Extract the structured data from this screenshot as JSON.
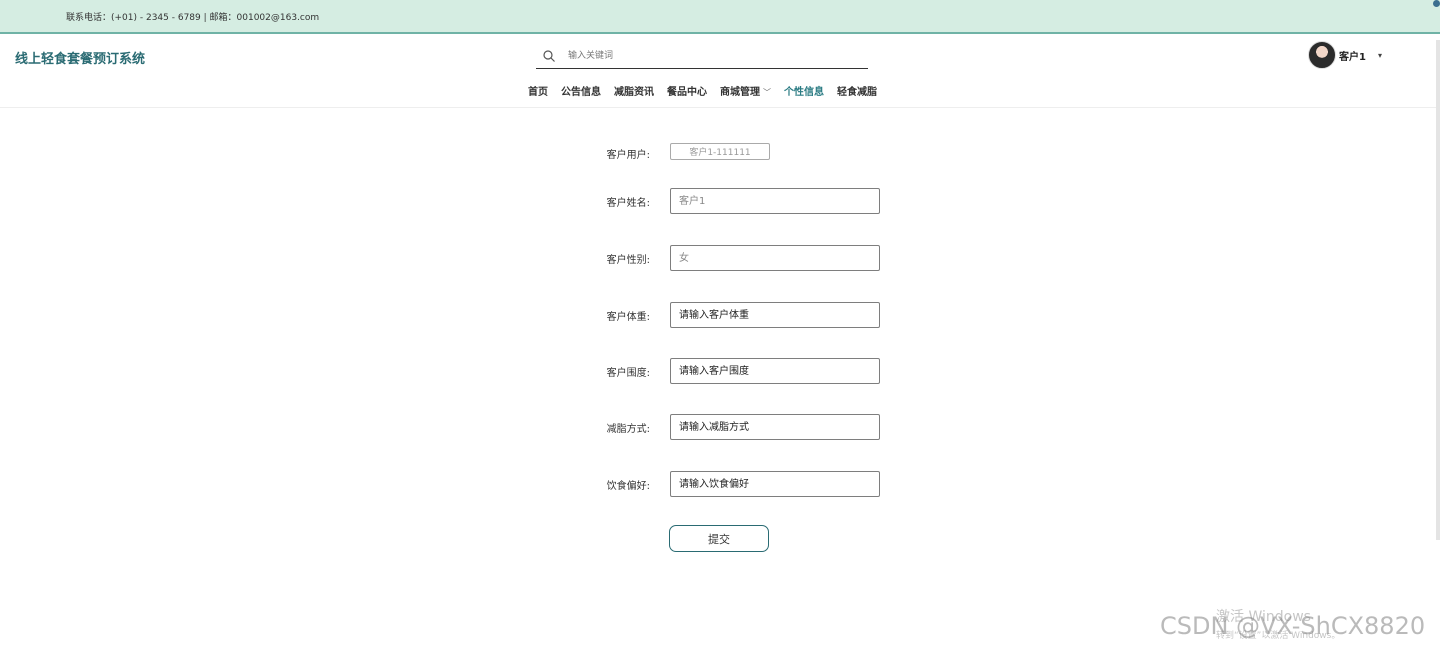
{
  "topbar": {
    "contact": "联系电话：(+01) - 2345 - 6789 | 邮箱：001002@163.com"
  },
  "header": {
    "site_title": "线上轻食套餐预订系统",
    "search_placeholder": "输入关键词",
    "user_name": "客户1",
    "user_caret": "▾"
  },
  "nav": {
    "items": [
      {
        "label": "首页"
      },
      {
        "label": "公告信息"
      },
      {
        "label": "减脂资讯"
      },
      {
        "label": "餐品中心"
      },
      {
        "label": "商城管理"
      },
      {
        "label": "个性信息"
      },
      {
        "label": "轻食减脂"
      }
    ],
    "active": "个性信息"
  },
  "form": {
    "fields": [
      {
        "label": "客户用户:",
        "value": "客户1-111111"
      },
      {
        "label": "客户姓名:",
        "placeholder": "客户1"
      },
      {
        "label": "客户性别:",
        "placeholder": "女"
      },
      {
        "label": "客户体重:",
        "placeholder": "请输入客户体重"
      },
      {
        "label": "客户围度:",
        "placeholder": "请输入客户围度"
      },
      {
        "label": "减脂方式:",
        "placeholder": "请输入减脂方式"
      },
      {
        "label": "饮食偏好:",
        "placeholder": "请输入饮食偏好"
      }
    ],
    "submit_label": "提交"
  },
  "overlay": {
    "watermark": "CSDN @VX-ShCX8820",
    "activation_title": "激活 Windows",
    "activation_sub": "转到“设置”以激活 Windows。"
  },
  "colors": {
    "topbar_bg": "#d5ede2",
    "brand": "#2a6b73",
    "active_nav": "#2a7b83"
  },
  "icons": {
    "search": "search-icon",
    "nav_dropdown": "chevron-down-icon",
    "user_dropdown": "caret-down-icon"
  }
}
